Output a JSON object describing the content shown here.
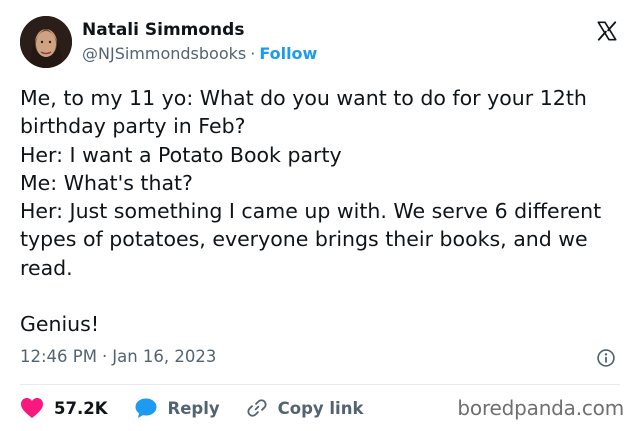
{
  "author": {
    "display_name": "Natali Simmonds",
    "handle": "@NJSimmondsbooks",
    "separator": "·",
    "follow_label": "Follow"
  },
  "tweet": {
    "text": "Me, to my 11 yo: What do you want to do for your 12th birthday party in Feb?\nHer: I want a Potato Book party\nMe: What's that?\nHer: Just something I came up with. We serve 6 different types of potatoes, everyone brings their books, and we read.\n\nGenius!",
    "time": "12:46 PM",
    "date": "Jan 16, 2023",
    "date_separator": "·"
  },
  "actions": {
    "likes": "57.2K",
    "reply_label": "Reply",
    "copy_link_label": "Copy link"
  },
  "watermark": "boredpanda.com",
  "colors": {
    "link_blue": "#1d9bf0",
    "like_red": "#f91880",
    "secondary_text": "#536471"
  },
  "icons": [
    "x-logo-icon",
    "info-icon",
    "heart-icon",
    "comment-bubble-icon",
    "link-icon"
  ]
}
